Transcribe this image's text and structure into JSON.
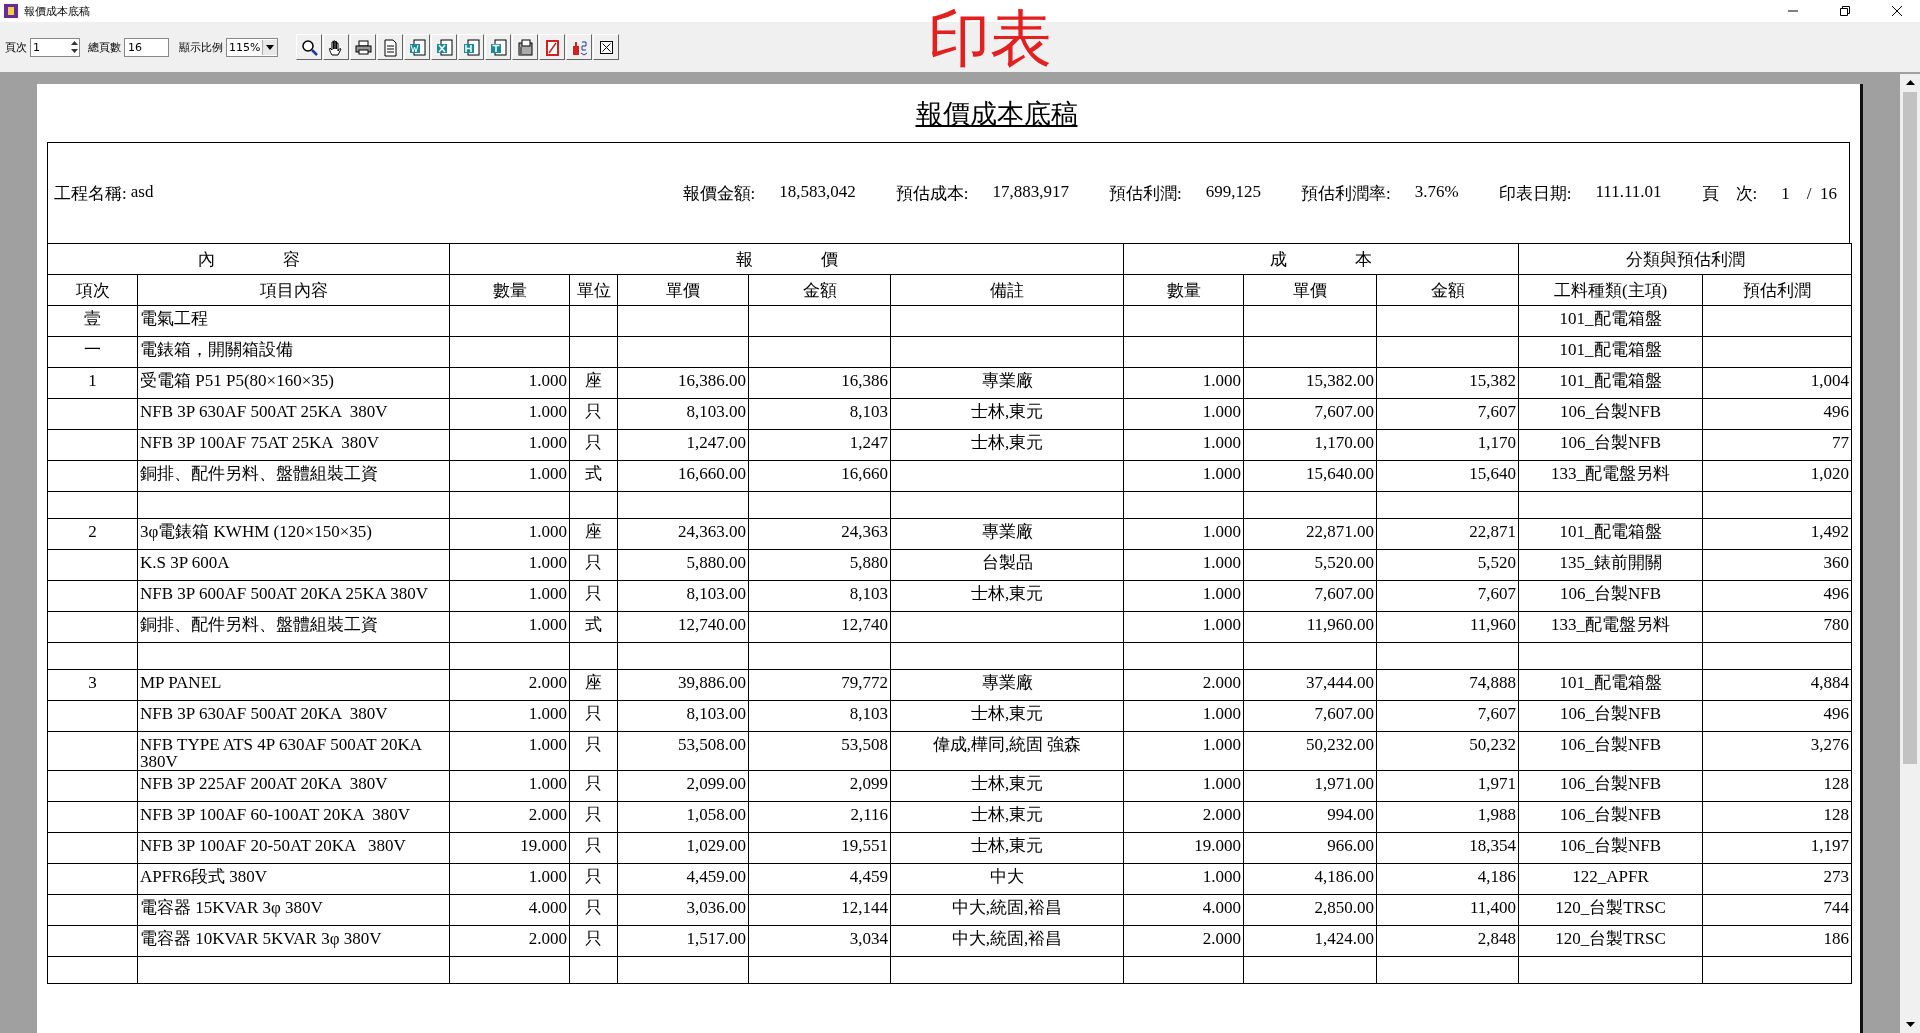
{
  "window": {
    "title": "報價成本底稿"
  },
  "toolbar": {
    "page_label": "頁次",
    "page_value": "1",
    "total_label": "總頁數",
    "total_value": "16",
    "zoom_label": "顯示比例",
    "zoom_value": "115%"
  },
  "annotation": "印表",
  "report": {
    "title": "報價成本底稿",
    "info": [
      {
        "label": "工程名稱:",
        "value": "asd"
      },
      {
        "label": "報價金額:",
        "value": "18,583,042"
      },
      {
        "label": "預估成本:",
        "value": "17,883,917"
      },
      {
        "label": "預估利潤:",
        "value": "699,125"
      },
      {
        "label": "預估利潤率:",
        "value": "3.76%"
      },
      {
        "label": "印表日期:",
        "value": "111.11.01"
      },
      {
        "label": "頁　次:",
        "value": "1　/  16"
      }
    ],
    "groups": [
      "內　　　　容",
      "報　　　　價",
      "成　　　　本",
      "分類與預估利潤"
    ],
    "columns": [
      "項次",
      "項目內容",
      "數量",
      "單位",
      "單價",
      "金額",
      "備註",
      "數量",
      "單價",
      "金額",
      "工料種類(主項)",
      "預估利潤"
    ],
    "rows": [
      {
        "kind": "item",
        "no": "壹",
        "content": "電氣工程",
        "category": "101_配電箱盤"
      },
      {
        "kind": "item",
        "no": "一",
        "content": "電錶箱，開關箱設備",
        "category": "101_配電箱盤"
      },
      {
        "kind": "item",
        "no": "1",
        "content": "受電箱 P51 P5(80×160×35)",
        "q_qty": "1.000",
        "unit": "座",
        "q_price": "16,386.00",
        "q_amount": "16,386",
        "remark": "專業廠",
        "c_qty": "1.000",
        "c_price": "15,382.00",
        "c_amount": "15,382",
        "category": "101_配電箱盤",
        "profit": "1,004"
      },
      {
        "kind": "item",
        "content": "NFB 3P 630AF 500AT 25KA  380V",
        "q_qty": "1.000",
        "unit": "只",
        "q_price": "8,103.00",
        "q_amount": "8,103",
        "remark": "士林,東元",
        "c_qty": "1.000",
        "c_price": "7,607.00",
        "c_amount": "7,607",
        "category": "106_台製NFB",
        "profit": "496"
      },
      {
        "kind": "item",
        "content": "NFB 3P 100AF 75AT 25KA  380V",
        "q_qty": "1.000",
        "unit": "只",
        "q_price": "1,247.00",
        "q_amount": "1,247",
        "remark": "士林,東元",
        "c_qty": "1.000",
        "c_price": "1,170.00",
        "c_amount": "1,170",
        "category": "106_台製NFB",
        "profit": "77"
      },
      {
        "kind": "item",
        "content": "銅排、配件另料、盤體組裝工資",
        "q_qty": "1.000",
        "unit": "式",
        "q_price": "16,660.00",
        "q_amount": "16,660",
        "c_qty": "1.000",
        "c_price": "15,640.00",
        "c_amount": "15,640",
        "category": "133_配電盤另料",
        "profit": "1,020"
      },
      {
        "kind": "blank"
      },
      {
        "kind": "item",
        "no": "2",
        "content": "3φ電錶箱 KWHM (120×150×35)",
        "q_qty": "1.000",
        "unit": "座",
        "q_price": "24,363.00",
        "q_amount": "24,363",
        "remark": "專業廠",
        "c_qty": "1.000",
        "c_price": "22,871.00",
        "c_amount": "22,871",
        "category": "101_配電箱盤",
        "profit": "1,492"
      },
      {
        "kind": "item",
        "content": "K.S 3P 600A",
        "q_qty": "1.000",
        "unit": "只",
        "q_price": "5,880.00",
        "q_amount": "5,880",
        "remark": "台製品",
        "c_qty": "1.000",
        "c_price": "5,520.00",
        "c_amount": "5,520",
        "category": "135_錶前開關",
        "profit": "360"
      },
      {
        "kind": "item",
        "content": "NFB 3P 600AF 500AT 20KA 25KA 380V",
        "q_qty": "1.000",
        "unit": "只",
        "q_price": "8,103.00",
        "q_amount": "8,103",
        "remark": "士林,東元",
        "c_qty": "1.000",
        "c_price": "7,607.00",
        "c_amount": "7,607",
        "category": "106_台製NFB",
        "profit": "496"
      },
      {
        "kind": "item",
        "content": "銅排、配件另料、盤體組裝工資",
        "q_qty": "1.000",
        "unit": "式",
        "q_price": "12,740.00",
        "q_amount": "12,740",
        "c_qty": "1.000",
        "c_price": "11,960.00",
        "c_amount": "11,960",
        "category": "133_配電盤另料",
        "profit": "780"
      },
      {
        "kind": "blank"
      },
      {
        "kind": "item",
        "no": "3",
        "content": "MP PANEL",
        "q_qty": "2.000",
        "unit": "座",
        "q_price": "39,886.00",
        "q_amount": "79,772",
        "remark": "專業廠",
        "c_qty": "2.000",
        "c_price": "37,444.00",
        "c_amount": "74,888",
        "category": "101_配電箱盤",
        "profit": "4,884"
      },
      {
        "kind": "item",
        "content": "NFB 3P 630AF 500AT 20KA  380V",
        "q_qty": "1.000",
        "unit": "只",
        "q_price": "8,103.00",
        "q_amount": "8,103",
        "remark": "士林,東元",
        "c_qty": "1.000",
        "c_price": "7,607.00",
        "c_amount": "7,607",
        "category": "106_台製NFB",
        "profit": "496"
      },
      {
        "kind": "item",
        "content": "NFB TYPE ATS 4P 630AF 500AT 20KA 380V",
        "q_qty": "1.000",
        "unit": "只",
        "q_price": "53,508.00",
        "q_amount": "53,508",
        "remark": "偉成,樺同,統固 強森",
        "c_qty": "1.000",
        "c_price": "50,232.00",
        "c_amount": "50,232",
        "category": "106_台製NFB",
        "profit": "3,276"
      },
      {
        "kind": "item",
        "content": "NFB 3P 225AF 200AT 20KA  380V",
        "q_qty": "1.000",
        "unit": "只",
        "q_price": "2,099.00",
        "q_amount": "2,099",
        "remark": "士林,東元",
        "c_qty": "1.000",
        "c_price": "1,971.00",
        "c_amount": "1,971",
        "category": "106_台製NFB",
        "profit": "128"
      },
      {
        "kind": "item",
        "content": "NFB 3P 100AF 60-100AT 20KA  380V",
        "q_qty": "2.000",
        "unit": "只",
        "q_price": "1,058.00",
        "q_amount": "2,116",
        "remark": "士林,東元",
        "c_qty": "2.000",
        "c_price": "994.00",
        "c_amount": "1,988",
        "category": "106_台製NFB",
        "profit": "128"
      },
      {
        "kind": "item",
        "content": "NFB 3P 100AF 20-50AT 20KA   380V",
        "q_qty": "19.000",
        "unit": "只",
        "q_price": "1,029.00",
        "q_amount": "19,551",
        "remark": "士林,東元",
        "c_qty": "19.000",
        "c_price": "966.00",
        "c_amount": "18,354",
        "category": "106_台製NFB",
        "profit": "1,197"
      },
      {
        "kind": "item",
        "content": "APFR6段式 380V",
        "q_qty": "1.000",
        "unit": "只",
        "q_price": "4,459.00",
        "q_amount": "4,459",
        "remark": "中大",
        "c_qty": "1.000",
        "c_price": "4,186.00",
        "c_amount": "4,186",
        "category": "122_APFR",
        "profit": "273"
      },
      {
        "kind": "item",
        "content": "電容器 15KVAR 3φ 380V",
        "q_qty": "4.000",
        "unit": "只",
        "q_price": "3,036.00",
        "q_amount": "12,144",
        "remark": "中大,統固,裕昌",
        "c_qty": "4.000",
        "c_price": "2,850.00",
        "c_amount": "11,400",
        "category": "120_台製TRSC",
        "profit": "744"
      },
      {
        "kind": "item",
        "content": "電容器 10KVAR 5KVAR 3φ 380V",
        "q_qty": "2.000",
        "unit": "只",
        "q_price": "1,517.00",
        "q_amount": "3,034",
        "remark": "中大,統固,裕昌",
        "c_qty": "2.000",
        "c_price": "1,424.00",
        "c_amount": "2,848",
        "category": "120_台製TRSC",
        "profit": "186"
      },
      {
        "kind": "blank"
      }
    ]
  }
}
